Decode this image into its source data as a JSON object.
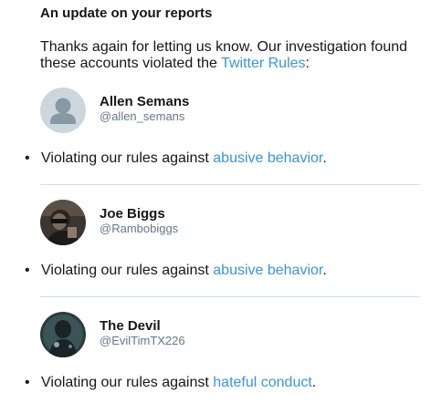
{
  "header": {
    "title": "An update on your reports"
  },
  "intro": {
    "text_before": "Thanks again for letting us know. Our investigation found these accounts violated the ",
    "link_text": "Twitter Rules",
    "text_after": ":"
  },
  "accounts": [
    {
      "name": "Allen Semans",
      "handle": "@allen_semans",
      "avatar_icon": "default-user-avatar",
      "violation_prefix": "Violating our rules against ",
      "violation_link": "abusive behavior",
      "violation_suffix": "."
    },
    {
      "name": "Joe Biggs",
      "handle": "@Rambobiggs",
      "avatar_icon": "photo-avatar",
      "violation_prefix": "Violating our rules against ",
      "violation_link": "abusive behavior",
      "violation_suffix": "."
    },
    {
      "name": "The Devil",
      "handle": "@EvilTimTX226",
      "avatar_icon": "dark-figure-avatar",
      "violation_prefix": "Violating our rules against ",
      "violation_link": "hateful conduct",
      "violation_suffix": "."
    }
  ],
  "bullet": "•",
  "colors": {
    "link": "#3b94d9",
    "text": "#14171a",
    "handle": "#657786",
    "divider": "#d8dde1"
  }
}
